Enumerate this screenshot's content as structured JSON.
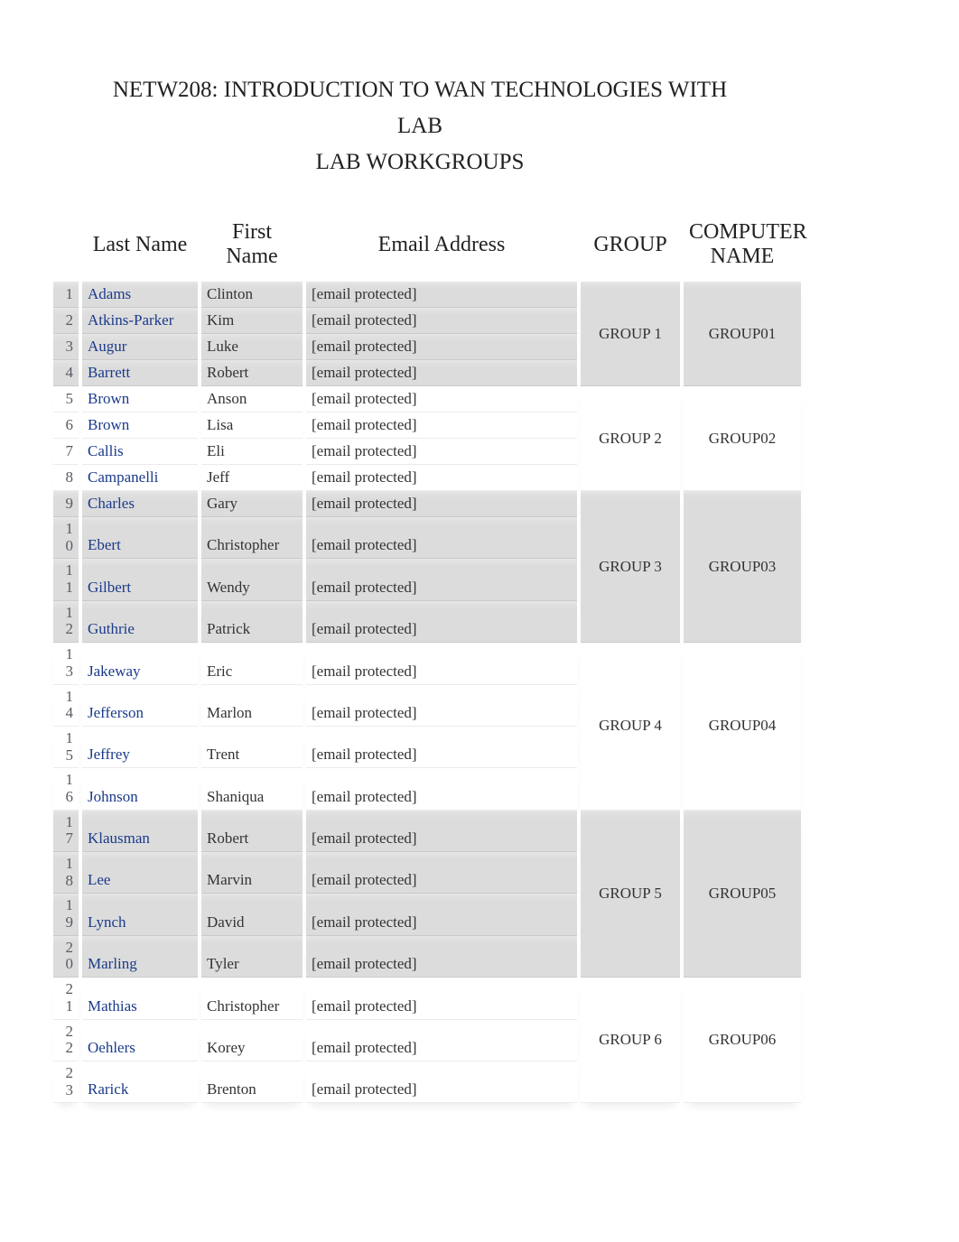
{
  "title": {
    "line1": "NETW208:  INTRODUCTION TO WAN TECHNOLOGIES WITH",
    "line2": "LAB",
    "line3": "LAB WORKGROUPS"
  },
  "columns": {
    "last": "Last Name",
    "first": "First Name",
    "email": "Email Address",
    "group": "GROUP",
    "computer": "COMPUTER NAME"
  },
  "groups": [
    {
      "group": "GROUP 1",
      "computer": "GROUP01",
      "shade": "odd",
      "rows": [
        {
          "n": "1",
          "last": "Adams",
          "first": "Clinton",
          "email": "[email protected]"
        },
        {
          "n": "2",
          "last": "Atkins-Parker",
          "first": "Kim",
          "email": "[email protected]"
        },
        {
          "n": "3",
          "last": "Augur",
          "first": "Luke",
          "email": "[email protected]"
        },
        {
          "n": "4",
          "last": "Barrett",
          "first": "Robert",
          "email": "[email protected]"
        }
      ]
    },
    {
      "group": "GROUP 2",
      "computer": "GROUP02",
      "shade": "even",
      "rows": [
        {
          "n": "5",
          "last": "Brown",
          "first": "Anson",
          "email": "[email protected]"
        },
        {
          "n": "6",
          "last": "Brown",
          "first": "Lisa",
          "email": "[email protected]"
        },
        {
          "n": "7",
          "last": "Callis",
          "first": "Eli",
          "email": "[email protected]"
        },
        {
          "n": "8",
          "last": "Campanelli",
          "first": "Jeff",
          "email": "[email protected]"
        }
      ]
    },
    {
      "group": "GROUP 3",
      "computer": "GROUP03",
      "shade": "odd",
      "rows": [
        {
          "n": "9",
          "last": "Charles",
          "first": "Gary",
          "email": "[email protected]"
        },
        {
          "n": "10",
          "last": "Ebert",
          "first": "Christopher",
          "email": "[email protected]"
        },
        {
          "n": "11",
          "last": "Gilbert",
          "first": "Wendy",
          "email": "[email protected]"
        },
        {
          "n": "12",
          "last": "Guthrie",
          "first": "Patrick",
          "email": "[email protected]"
        }
      ]
    },
    {
      "group": "GROUP 4",
      "computer": "GROUP04",
      "shade": "even",
      "rows": [
        {
          "n": "13",
          "last": "Jakeway",
          "first": "Eric",
          "email": "[email protected]"
        },
        {
          "n": "14",
          "last": "Jefferson",
          "first": "Marlon",
          "email": "[email protected]"
        },
        {
          "n": "15",
          "last": "Jeffrey",
          "first": "Trent",
          "email": "[email protected]"
        },
        {
          "n": "16",
          "last": "Johnson",
          "first": "Shaniqua",
          "email": "[email protected]"
        }
      ]
    },
    {
      "group": "GROUP 5",
      "computer": "GROUP05",
      "shade": "odd",
      "rows": [
        {
          "n": "17",
          "last": "Klausman",
          "first": "Robert",
          "email": "[email protected]"
        },
        {
          "n": "18",
          "last": "Lee",
          "first": "Marvin",
          "email": "[email protected]"
        },
        {
          "n": "19",
          "last": "Lynch",
          "first": "David",
          "email": "[email protected]"
        },
        {
          "n": "20",
          "last": "Marling",
          "first": "Tyler",
          "email": "[email protected]"
        }
      ]
    },
    {
      "group": "GROUP 6",
      "computer": "GROUP06",
      "shade": "even",
      "rows": [
        {
          "n": "21",
          "last": "Mathias",
          "first": "Christopher",
          "email": "[email protected]"
        },
        {
          "n": "22",
          "last": "Oehlers",
          "first": "Korey",
          "email": "[email protected]"
        },
        {
          "n": "23",
          "last": "Rarick",
          "first": "Brenton",
          "email": "[email protected]"
        }
      ]
    }
  ]
}
